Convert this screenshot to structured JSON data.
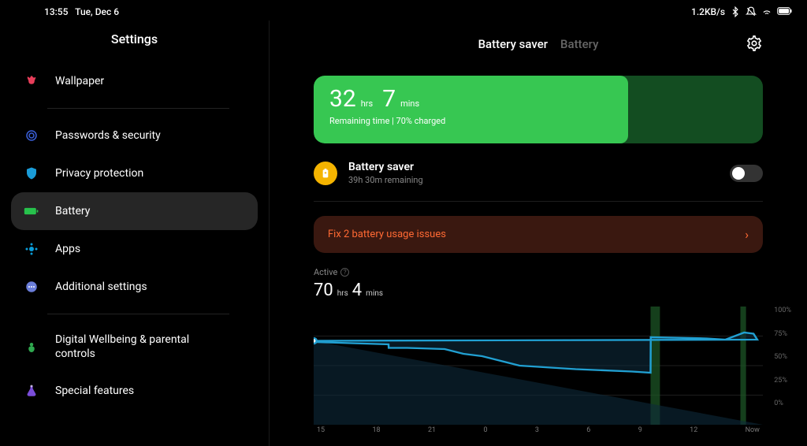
{
  "statusbar": {
    "time": "13:55",
    "date": "Tue, Dec 6",
    "net_speed": "1.2KB/s"
  },
  "sidebar": {
    "title": "Settings",
    "items": [
      {
        "label": "Wallpaper"
      },
      {
        "label": "Passwords & security"
      },
      {
        "label": "Privacy protection"
      },
      {
        "label": "Battery"
      },
      {
        "label": "Apps"
      },
      {
        "label": "Additional settings"
      },
      {
        "label": "Digital Wellbeing & parental controls"
      },
      {
        "label": "Special features"
      }
    ]
  },
  "tabs": {
    "saver": "Battery saver",
    "battery": "Battery"
  },
  "battery_card": {
    "hours": "32",
    "hours_unit": "hrs",
    "mins": "7",
    "mins_unit": "mins",
    "subtitle": "Remaining time | 70% charged",
    "fill_percent": 70
  },
  "saver": {
    "title": "Battery saver",
    "subtitle": "39h 30m remaining",
    "enabled": false
  },
  "issues": {
    "text": "Fix 2 battery usage issues"
  },
  "active": {
    "label": "Active",
    "hours": "70",
    "hours_unit": "hrs",
    "mins": "4",
    "mins_unit": "mins"
  },
  "chart_data": {
    "type": "area",
    "xlabel": "",
    "ylabel": "",
    "ylim": [
      0,
      100
    ],
    "y_ticks": [
      "100%",
      "75%",
      "50%",
      "25%",
      "0%"
    ],
    "x_ticks": [
      "15",
      "18",
      "21",
      "0",
      "3",
      "6",
      "9",
      "12",
      "Now"
    ],
    "series": [
      {
        "name": "battery_level",
        "color": "#21a0d2",
        "x": [
          13,
          15,
          17,
          17.01,
          18,
          20,
          21,
          22,
          23,
          0,
          2,
          3,
          6,
          7,
          7.01,
          10,
          11,
          12,
          12.5,
          12.7,
          13
        ],
        "values": [
          70,
          69,
          68,
          65,
          65,
          64,
          60,
          58,
          54,
          50,
          48,
          47,
          45,
          44,
          74,
          73,
          72,
          78,
          77,
          72,
          71
        ]
      }
    ],
    "charging_regions": [
      {
        "x_start": 7,
        "x_end": 7.5
      },
      {
        "x_start": 11.8,
        "x_end": 12.1
      }
    ]
  }
}
